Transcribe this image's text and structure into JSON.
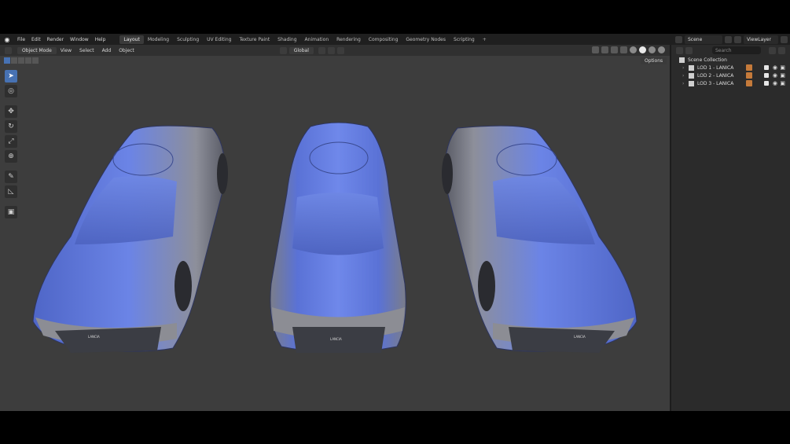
{
  "menu": [
    "File",
    "Edit",
    "Render",
    "Window",
    "Help"
  ],
  "workspaces": [
    "Layout",
    "Modeling",
    "Sculpting",
    "UV Editing",
    "Texture Paint",
    "Shading",
    "Animation",
    "Rendering",
    "Compositing",
    "Geometry Nodes",
    "Scripting"
  ],
  "active_workspace": "Layout",
  "scene_name": "Scene",
  "view_layer": "ViewLayer",
  "viewport_header": {
    "mode": "Object Mode",
    "view": "View",
    "select": "Select",
    "add": "Add",
    "object": "Object",
    "orientation": "Global",
    "options": "Options"
  },
  "outliner": {
    "search_placeholder": "Search",
    "root": "Scene Collection",
    "items": [
      {
        "label": "LOD 1 - LANICA"
      },
      {
        "label": "LOD 2 - LANICA"
      },
      {
        "label": "LOD 3 - LANICA"
      }
    ]
  },
  "model_badge": "LANCIA",
  "colors": {
    "accent": "#4772b3",
    "car_body": "#5b77d9"
  }
}
